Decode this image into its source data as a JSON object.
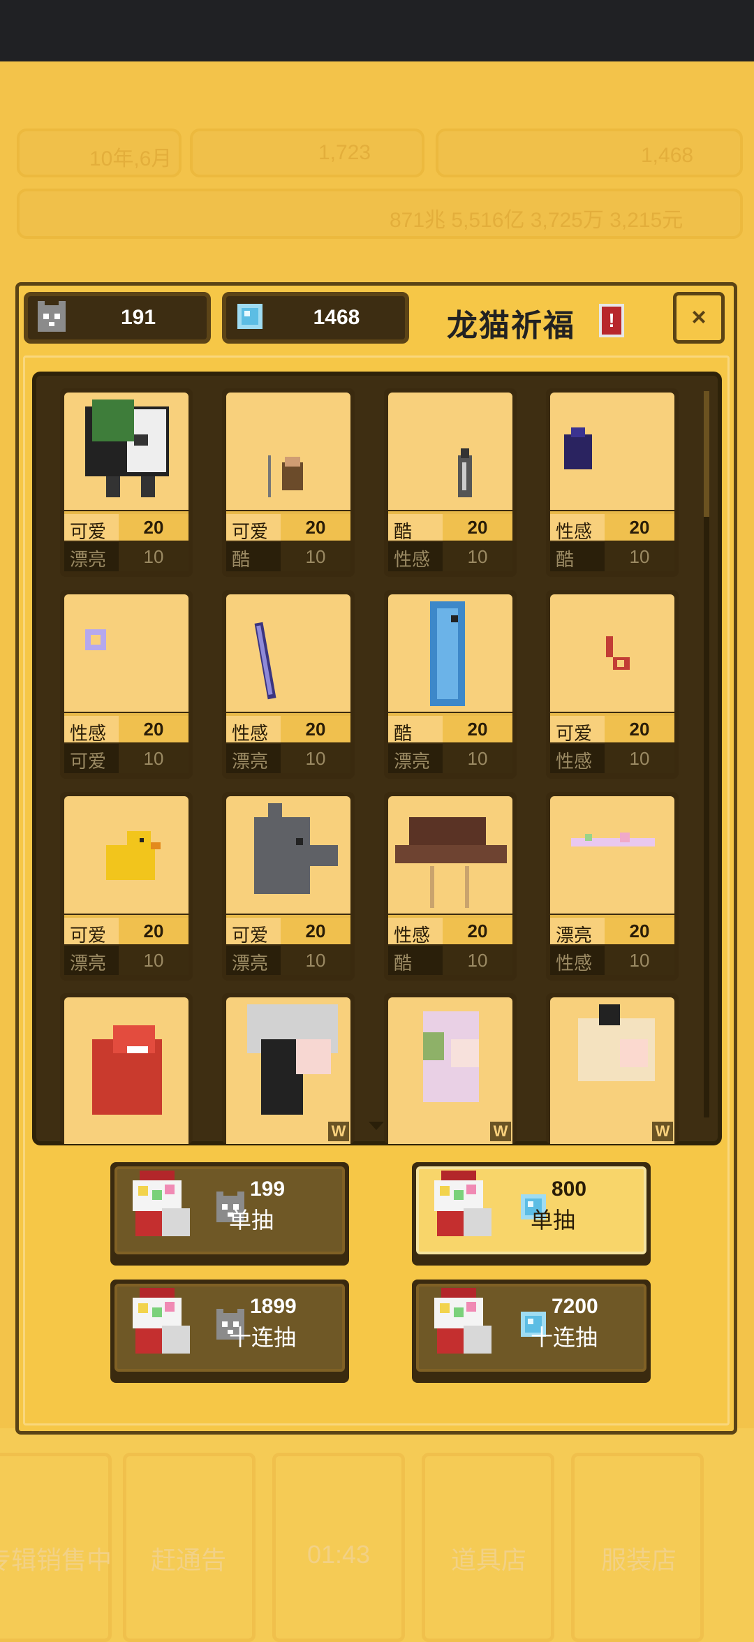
{
  "background": {
    "date": "10年,6月",
    "coins": "1,723",
    "gems": "1,468",
    "money": "871兆 5,516亿 3,725万 3,215元",
    "nav": [
      "专辑销售中",
      "赶通告",
      "01:43",
      "道具店",
      "服装店"
    ]
  },
  "header": {
    "cat_currency": "191",
    "gem_currency": "1468",
    "title": "龙猫祈福",
    "info_symbol": "!",
    "close_symbol": "×"
  },
  "items": [
    {
      "a": "可爱",
      "av": "20",
      "b": "漂亮",
      "bv": "10",
      "icon": "panda-icon"
    },
    {
      "a": "可爱",
      "av": "20",
      "b": "酷",
      "bv": "10",
      "icon": "tiny-warrior-icon"
    },
    {
      "a": "酷",
      "av": "20",
      "b": "性感",
      "bv": "10",
      "icon": "bottle-icon"
    },
    {
      "a": "性感",
      "av": "20",
      "b": "酷",
      "bv": "10",
      "icon": "bat-wing-icon"
    },
    {
      "a": "性感",
      "av": "20",
      "b": "可爱",
      "bv": "10",
      "icon": "ring-icon"
    },
    {
      "a": "性感",
      "av": "20",
      "b": "漂亮",
      "bv": "10",
      "icon": "wand-icon"
    },
    {
      "a": "酷",
      "av": "20",
      "b": "漂亮",
      "bv": "10",
      "icon": "fish-icon"
    },
    {
      "a": "可爱",
      "av": "20",
      "b": "性感",
      "bv": "10",
      "icon": "key-icon"
    },
    {
      "a": "可爱",
      "av": "20",
      "b": "漂亮",
      "bv": "10",
      "icon": "duck-icon"
    },
    {
      "a": "可爱",
      "av": "20",
      "b": "漂亮",
      "bv": "10",
      "icon": "cat-head-icon"
    },
    {
      "a": "性感",
      "av": "20",
      "b": "酷",
      "bv": "10",
      "icon": "cowboy-hat-icon"
    },
    {
      "a": "漂亮",
      "av": "20",
      "b": "性感",
      "bv": "10",
      "icon": "flower-string-icon"
    },
    {
      "icon": "lion-dance-icon",
      "badge": ""
    },
    {
      "icon": "silver-hair-icon",
      "badge": "W"
    },
    {
      "icon": "headphone-girl-icon",
      "badge": "W"
    },
    {
      "icon": "blonde-bun-icon",
      "badge": "W"
    }
  ],
  "buttons": [
    {
      "cost": "199",
      "label": "单抽",
      "currency": "cat",
      "active": false
    },
    {
      "cost": "800",
      "label": "单抽",
      "currency": "gem",
      "active": true
    },
    {
      "cost": "1899",
      "label": "十连抽",
      "currency": "cat",
      "active": false
    },
    {
      "cost": "7200",
      "label": "十连抽",
      "currency": "gem",
      "active": false
    }
  ],
  "colors": {
    "accent": "#f6c747",
    "dark": "#3e2e12",
    "card": "#f8d07c"
  }
}
